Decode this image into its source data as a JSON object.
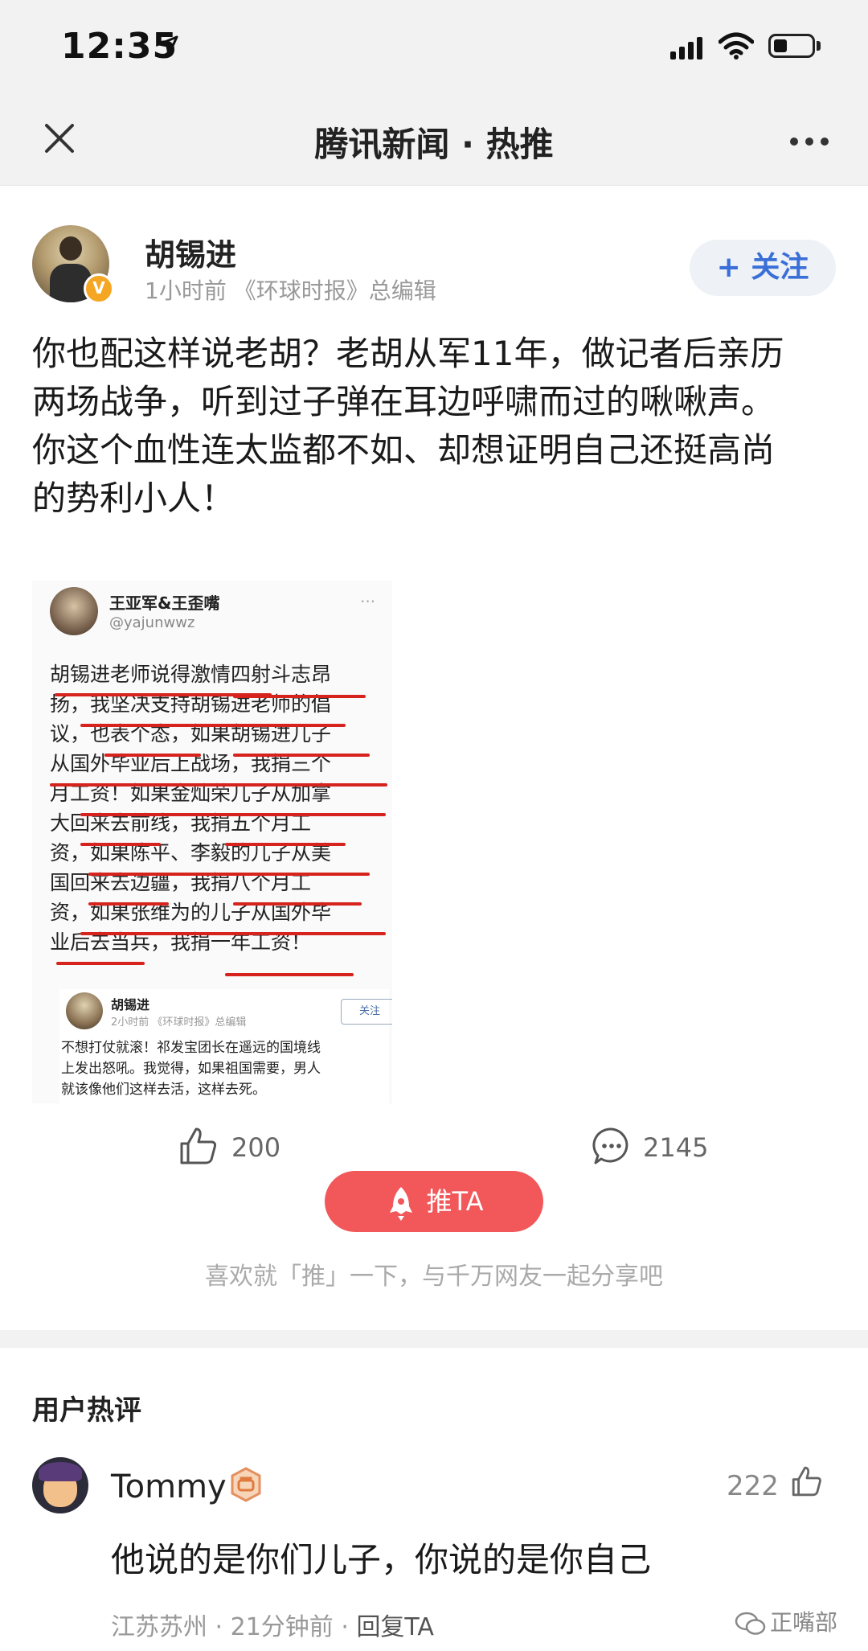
{
  "status_bar": {
    "time": "12:35"
  },
  "nav": {
    "title": "腾讯新闻 · 热推"
  },
  "post": {
    "author": "胡锡进",
    "meta": "1小时前 《环球时报》总编辑",
    "follow_label": "+ 关注",
    "text_lines": [
      "你也配这样说老胡？老胡从军11年，做记者后亲历",
      "两场战争，听到过子弹在耳边呼啸而过的啾啾声。",
      "你这个血性连太监都不如、却想证明自己还挺高尚",
      "的势利小人！"
    ],
    "embedded_image": {
      "name": "王亚军&王歪嘴",
      "handle": "@yajunwwz",
      "dots": "···",
      "lines": [
        "胡锡进老师说得激情四射斗志昂",
        "扬，我坚决支持胡锡进老师的倡",
        "议，也表个态，如果胡锡进儿子",
        "从国外毕业后上战场，我捐三个",
        "月工资！如果金灿荣儿子从加拿",
        "大回来去前线，我捐五个月工",
        "资，如果陈平、李毅的儿子从美",
        "国回来去边疆，我捐八个月工",
        "资，如果张维为的儿子从国外毕",
        "业后去当兵，我捐一年工资！"
      ],
      "quoted": {
        "author": "胡锡进",
        "meta": "2小时前 《环球时报》总编辑",
        "follow_label": "关注",
        "lines": [
          "不想打仗就滚！祁发宝团长在遥远的国境线",
          "上发出怒吼。我觉得，如果祖国需要，男人",
          "就该像他们这样去活，这样去死。"
        ]
      }
    },
    "likes": "200",
    "comments": "2145",
    "push_label": "推TA",
    "push_hint": "喜欢就「推」一下，与千万网友一起分享吧"
  },
  "comments_section": {
    "title": "用户热评",
    "items": [
      {
        "user": "Tommy",
        "likes": "222",
        "text": "他说的是你们儿子，你说的是你自己",
        "location": "江苏苏州",
        "time": "21分钟前",
        "reply_label": "回复TA"
      }
    ]
  },
  "watermark": "正嘴部",
  "colors": {
    "push": "#f2575a",
    "follow_text": "#3a6fd8",
    "underline": "#d6231e"
  }
}
